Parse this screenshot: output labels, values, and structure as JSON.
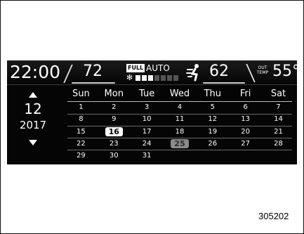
{
  "status": {
    "clock": "22:00",
    "driver_temp": "72",
    "fan_mode_badge": "FULL",
    "fan_mode_text": "AUTO",
    "fan_level": {
      "on": 3,
      "total": 7
    },
    "passenger_temp": "62",
    "out_temp_label_line1": "OUT",
    "out_temp_label_line2": "TEMP",
    "out_temp_value": "55",
    "out_temp_unit": "°F"
  },
  "side_panel": {
    "month": "12",
    "year": "2017"
  },
  "calendar": {
    "weekdays": [
      "Sun",
      "Mon",
      "Tue",
      "Wed",
      "Thu",
      "Fri",
      "Sat"
    ],
    "weeks": [
      [
        "1",
        "2",
        "3",
        "4",
        "5",
        "6",
        "7"
      ],
      [
        "8",
        "9",
        "10",
        "11",
        "12",
        "13",
        "14"
      ],
      [
        "15",
        "16",
        "17",
        "18",
        "19",
        "20",
        "21"
      ],
      [
        "22",
        "23",
        "24",
        "25",
        "26",
        "27",
        "28"
      ],
      [
        "29",
        "30",
        "31",
        "",
        "",
        "",
        ""
      ]
    ],
    "selected_day": "16",
    "highlighted_day": "25"
  },
  "figure_number": "305202",
  "colors": {
    "display_bg": "#050505",
    "text": "#ffffff",
    "selected_bg": "#ffffff",
    "highlight_bg": "#8a8a8a"
  },
  "icons": {
    "fan": "fan-icon",
    "airflow": "airflow-icon",
    "up": "arrow-up-icon",
    "down": "arrow-down-icon"
  }
}
